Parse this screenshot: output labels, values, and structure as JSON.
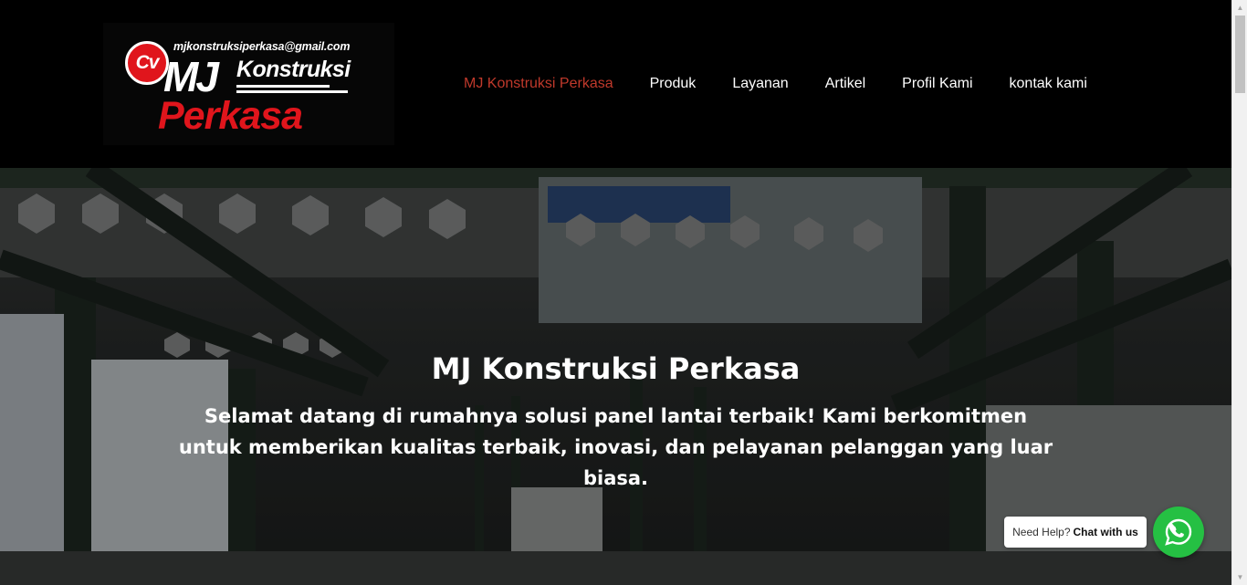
{
  "logo": {
    "email": "mjkonstruksiperkasa@gmail.com",
    "badge": "Cv",
    "mj": "MJ",
    "konstruksi": "Konstruksi",
    "perkasa": "Perkasa"
  },
  "nav": {
    "items": [
      {
        "label": "MJ Konstruksi Perkasa",
        "active": true
      },
      {
        "label": "Produk"
      },
      {
        "label": "Layanan"
      },
      {
        "label": "Artikel"
      },
      {
        "label": "Profil Kami"
      },
      {
        "label": "kontak kami"
      }
    ]
  },
  "hero": {
    "title": "MJ Konstruksi Perkasa",
    "subtitle": "Selamat datang di rumahnya solusi panel lantai terbaik! Kami berkomitmen untuk memberikan kualitas terbaik, inovasi, dan pelayanan pelanggan yang luar biasa."
  },
  "whatsapp": {
    "prompt": "Need Help?",
    "cta": "Chat with us",
    "icon": "whatsapp-icon"
  },
  "colors": {
    "accent": "#c0392b",
    "brand_red": "#e0151c",
    "whatsapp_green": "#25c043"
  }
}
